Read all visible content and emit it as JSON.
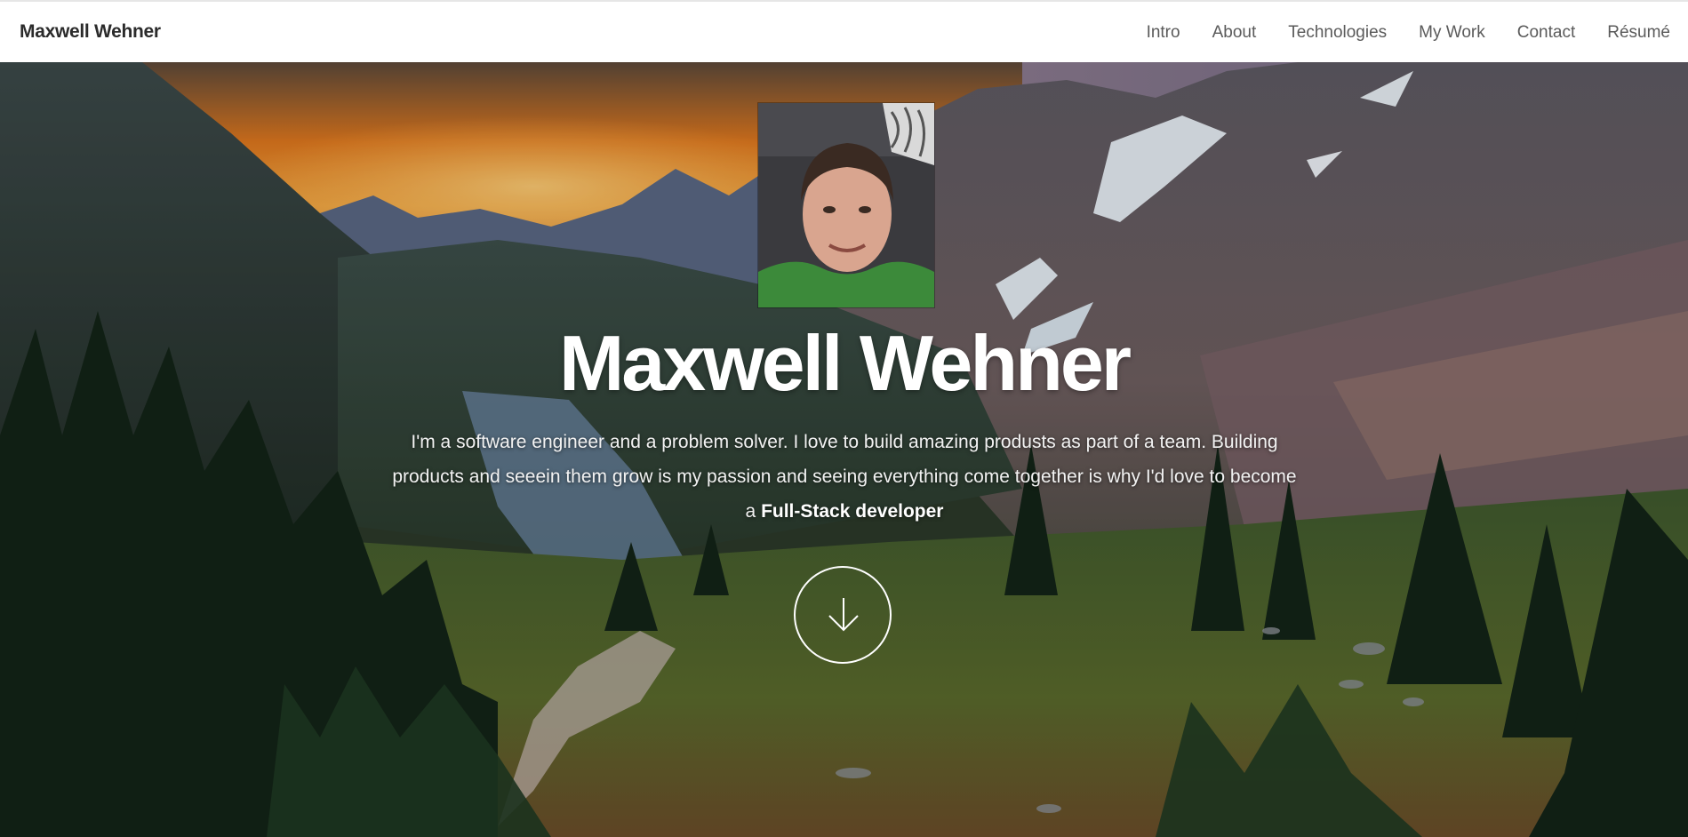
{
  "navbar": {
    "brand": "Maxwell Wehner",
    "links": [
      "Intro",
      "About",
      "Technologies",
      "My Work",
      "Contact",
      "Résumé"
    ]
  },
  "hero": {
    "title": "Maxwell Wehner",
    "intro_text": "I'm a software engineer and a problem solver. I love to build amazing produsts as part of a team. Building products and seeein them grow is my passion and seeing everything come together is why I'd love to become a",
    "intro_emphasis": "Full-Stack developer",
    "scroll_icon": "arrow-down-icon"
  },
  "colors": {
    "nav_background": "#ffffff",
    "nav_text": "#5a5a5a",
    "brand_text": "#2b2b2b",
    "hero_text": "#ffffff",
    "sunset_orange": "#f08a2a"
  }
}
